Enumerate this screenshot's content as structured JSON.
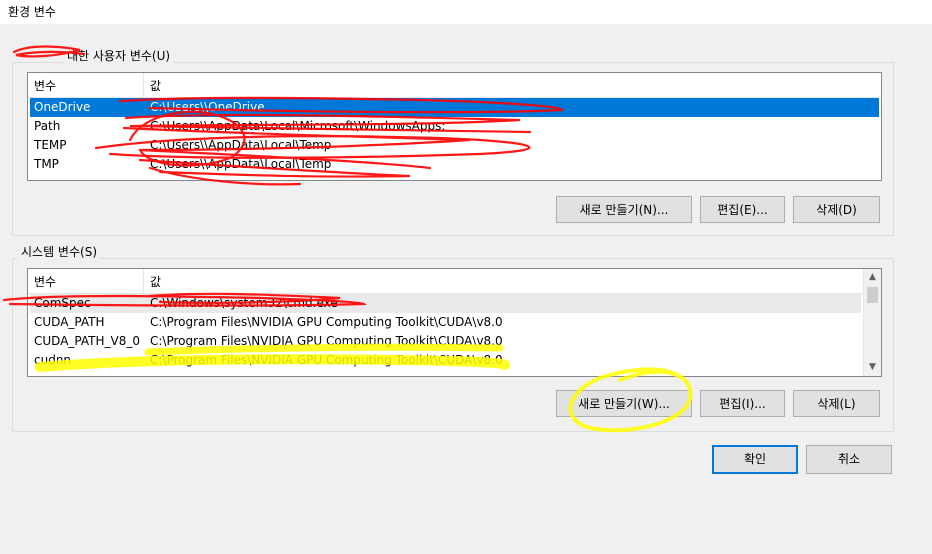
{
  "window": {
    "title": "환경 변수"
  },
  "user_section": {
    "label": " 대한 사용자 변수(U)",
    "columns": [
      "변수",
      "값"
    ],
    "rows": [
      {
        "name": "OneDrive",
        "value": "C:\\Users\\\\OneDrive",
        "selected": true
      },
      {
        "name": "Path",
        "value": "C:\\Users\\\\AppData\\Local\\Microsoft\\WindowsApps;",
        "selected": false
      },
      {
        "name": "TEMP",
        "value": "C:\\Users\\\\AppData\\Local\\Temp",
        "selected": false
      },
      {
        "name": "TMP",
        "value": "C:\\Users\\\\AppData\\Local\\Temp",
        "selected": false
      }
    ],
    "buttons": {
      "new": "새로 만들기(N)...",
      "edit": "편집(E)...",
      "delete": "삭제(D)"
    }
  },
  "system_section": {
    "label": "시스템 변수(S)",
    "columns": [
      "변수",
      "값"
    ],
    "rows": [
      {
        "name": "ComSpec",
        "value": "C:\\Windows\\system32\\cmd.exe",
        "selected": false
      },
      {
        "name": "CUDA_PATH",
        "value": "C:\\Program Files\\NVIDIA GPU Computing Toolkit\\CUDA\\v8.0",
        "selected": false
      },
      {
        "name": "CUDA_PATH_V8_0",
        "value": "C:\\Program Files\\NVIDIA GPU Computing Toolkit\\CUDA\\v8.0",
        "selected": false
      },
      {
        "name": "cudnn",
        "value": "C:\\Program Files\\NVIDIA GPU Computing Toolkit\\CUDA\\v8.0",
        "selected": false
      }
    ],
    "buttons": {
      "new": "새로 만들기(W)...",
      "edit": "편집(I)...",
      "delete": "삭제(L)"
    }
  },
  "footer": {
    "ok": "확인",
    "cancel": "취소"
  },
  "colors": {
    "selection": "#0078d7",
    "redaction": "#ff0000",
    "highlight": "#ffff00"
  }
}
